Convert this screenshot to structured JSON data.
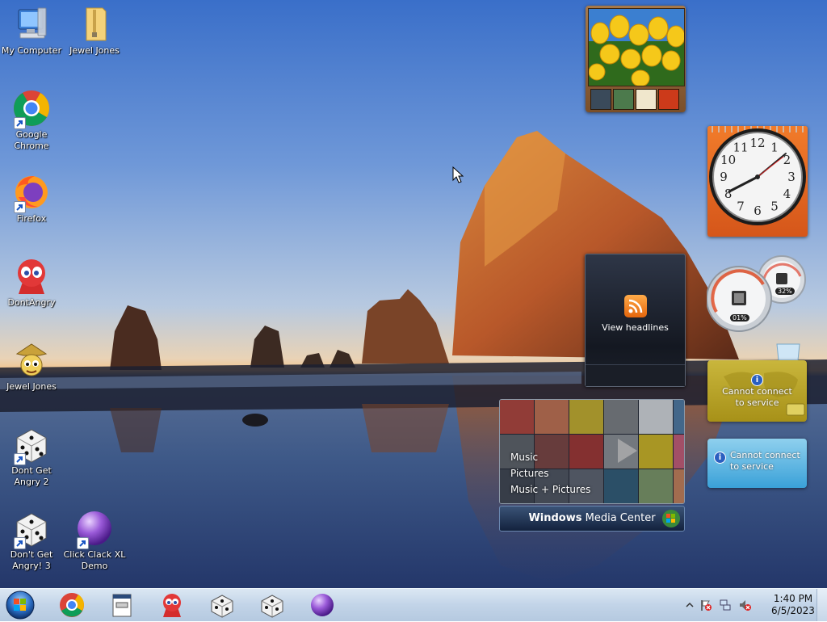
{
  "desktop": {
    "icons": [
      {
        "label": "My Computer"
      },
      {
        "label": "Jewel Jones"
      },
      {
        "label": "Google\nChrome"
      },
      {
        "label": "Firefox"
      },
      {
        "label": "DontAngry"
      },
      {
        "label": "Jewel Jones"
      },
      {
        "label": "Dont Get\nAngry 2"
      },
      {
        "label": "Don't Get\nAngry! 3"
      },
      {
        "label": "Click Clack XL\nDemo"
      }
    ]
  },
  "gadgets": {
    "clock": {
      "numbers": [
        "12",
        "1",
        "2",
        "3",
        "4",
        "5",
        "6",
        "7",
        "8",
        "9",
        "10",
        "11"
      ]
    },
    "feed": {
      "label": "View headlines"
    },
    "meter": {
      "cpu": "01%",
      "memory": "32%"
    },
    "weather": {
      "message": "Cannot connect\nto service"
    },
    "currency": {
      "message": "Cannot connect\nto service"
    },
    "media_center": {
      "menu": [
        "Music",
        "Pictures",
        "Music + Pictures"
      ],
      "title_bold": "Windows",
      "title_rest": " Media Center"
    }
  },
  "taskbar": {
    "time": "1:40 PM",
    "date": "6/5/2023"
  },
  "colors": {
    "taskbar": "#c2d4e8",
    "clock_frame": "#e8641f",
    "weather_bg": "#c0aa2c",
    "currency_bg": "#5fb8e4"
  }
}
